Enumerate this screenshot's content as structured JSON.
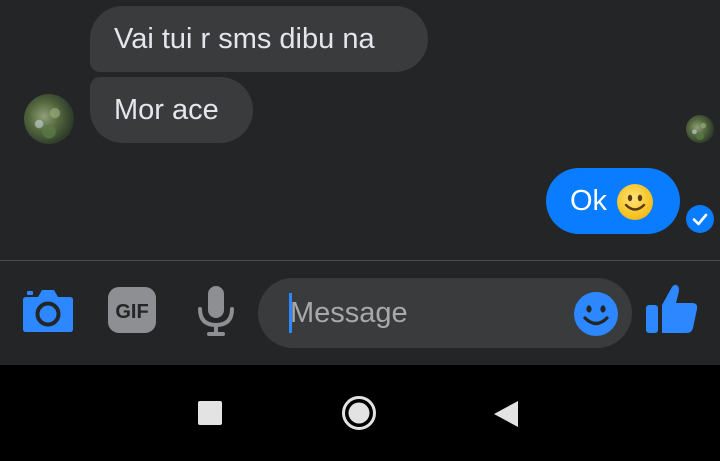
{
  "messages": {
    "incoming": [
      {
        "text": "Vai tui r sms dibu na"
      },
      {
        "text": "Mor ace"
      }
    ],
    "outgoing": [
      {
        "text": "Ok",
        "emoji": "slightly-smiling-face-emoji"
      }
    ],
    "status_icon": "check-circle-icon"
  },
  "composer": {
    "placeholder": "Message",
    "value": "",
    "icons": [
      "camera-icon",
      "gif-icon",
      "microphone-icon",
      "emoji-icon",
      "thumbs-up-icon"
    ]
  },
  "navbar": {
    "icons": [
      "square-icon",
      "circle-home-icon",
      "triangle-back-icon"
    ]
  },
  "colors": {
    "background": "#242526",
    "incoming_bubble": "#3a3b3c",
    "outgoing_bubble": "#0a7cff",
    "accent": "#2d88ff",
    "navbar": "#000000"
  }
}
